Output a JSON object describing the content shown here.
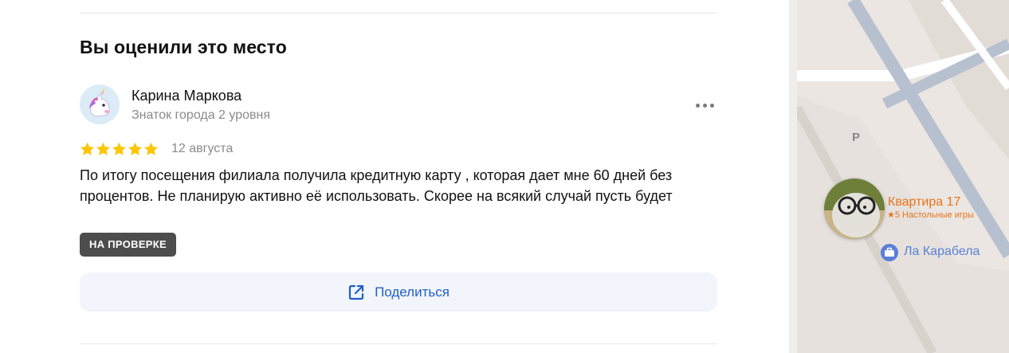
{
  "review_section": {
    "heading": "Вы оценили это место",
    "author": {
      "name": "Карина Маркова",
      "level": "Знаток города 2 уровня",
      "avatar_icon": "unicorn-icon"
    },
    "more_icon": "more-dots-icon",
    "rating": {
      "value": 5,
      "max": 5,
      "star_color": "#FCC603"
    },
    "date": "12 августа",
    "text": "По итогу посещения филиала получила кредитную карту , которая дает мне 60 дней без процентов. Не планирую активно её использовать. Скорее на всякий случай пусть будет",
    "status_badge": "НА ПРОВЕРКЕ",
    "share": {
      "label": "Поделиться",
      "icon": "share-icon",
      "color": "#1F5FC9"
    }
  },
  "map": {
    "parking_label": "P",
    "places": [
      {
        "name": "Квартира 17",
        "subtitle": "★5 Настольные игры",
        "color": "#E8731A",
        "icon": "place-photo"
      },
      {
        "name": "Ла Карабела",
        "color": "#5A7FD6",
        "icon": "briefcase-icon"
      }
    ]
  }
}
